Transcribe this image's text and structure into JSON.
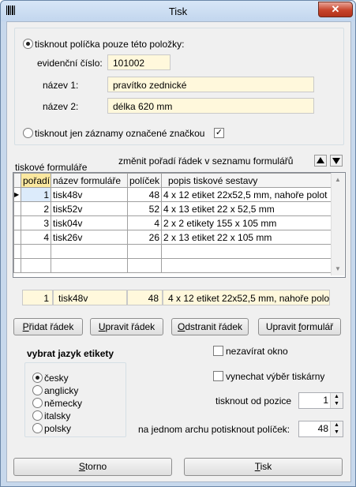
{
  "window": {
    "title": "Tisk",
    "close_label": "✕"
  },
  "scope": {
    "radio_item_label": "tisknout políčka pouze této položky:",
    "evid_label": "evidenční číslo:",
    "evid_value": "101002",
    "name1_label": "název 1:",
    "name1_value": "pravítko zednické",
    "name2_label": "název 2:",
    "name2_value": "délka 620 mm",
    "radio_marked_label": "tisknout jen záznamy označené značkou",
    "marked_checked": "✓"
  },
  "forms": {
    "title": "tiskové formuláře",
    "reorder_label": "změnit pořadí řádek v seznamu formulářů",
    "columns": [
      "pořadí",
      "název formuláře",
      "políček",
      "popis tiskové sestavy"
    ],
    "rows": [
      [
        "1",
        "tisk48v",
        "48",
        "4 x 12 etiket 22x52,5 mm, nahoře polot"
      ],
      [
        "2",
        "tisk52v",
        "52",
        "4 x 13 etiket 22 x 52,5 mm"
      ],
      [
        "3",
        "tisk04v",
        "4",
        "2 x 2 etikety 155 x 105 mm"
      ],
      [
        "4",
        "tisk26v",
        "26",
        "2 x 13 etiket 22 x 105 mm"
      ]
    ],
    "row_marker": "▶",
    "selected": {
      "order": "1",
      "name": "tisk48v",
      "fields": "48",
      "desc": "4 x 12 etiket 22x52,5 mm, nahoře polo"
    }
  },
  "actions": {
    "add_pre": "P",
    "add_post": "řidat řádek",
    "edit_pre": "U",
    "edit_post": "pravit řádek",
    "remove_pre": "O",
    "remove_post": "dstranit řádek",
    "editform_pre": "Upravit ",
    "editform_u": "f",
    "editform_post": "ormulář"
  },
  "language": {
    "title": "vybrat jazyk etikety",
    "options": [
      "česky",
      "anglicky",
      "německy",
      "italsky",
      "polsky"
    ],
    "selected": "česky"
  },
  "options": {
    "noclose_label": "nezavírat okno",
    "skipprinter_label": "vynechat výběr tiskárny",
    "startpos_label": "tisknout od pozice",
    "startpos_value": "1",
    "persheet_label": "na jednom archu potisknout políček:",
    "persheet_value": "48"
  },
  "footer": {
    "cancel_u": "S",
    "cancel_rest": "torno",
    "print_u": "T",
    "print_rest": "isk"
  }
}
